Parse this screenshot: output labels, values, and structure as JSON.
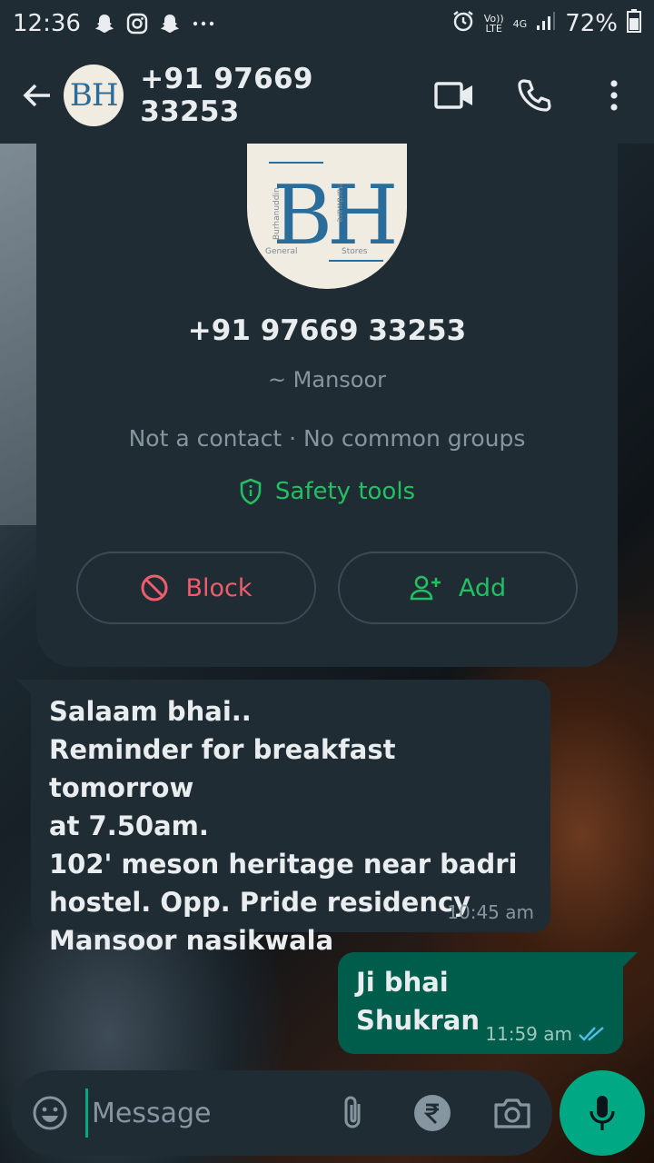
{
  "status_bar": {
    "time": "12:36",
    "network_top": "Vo))",
    "network_bottom": "LTE",
    "signal": "4G",
    "battery": "72%"
  },
  "header": {
    "title": "+91 97669 33253",
    "avatar_text": "BH"
  },
  "contact_card": {
    "phone": "+91 97669 33253",
    "name": "~ Mansoor",
    "info": "Not a contact · No common groups",
    "safety_label": "Safety tools",
    "block_label": "Block",
    "add_label": "Add",
    "avatar_text": "BH",
    "avatar_small_left": "Burhanuddin",
    "avatar_small_right": "Hardware",
    "avatar_bottom_left": "General",
    "avatar_bottom_right": "Stores"
  },
  "messages": [
    {
      "direction": "incoming",
      "text": "Salaam bhai..\nReminder for breakfast tomorrow\nat 7.50am.\n102' meson heritage near badri\nhostel. Opp. Pride residency\nMansoor nasikwala",
      "time": "10:45 am"
    },
    {
      "direction": "outgoing",
      "text": "Ji bhai\nShukran",
      "time": "11:59 am",
      "read": true
    }
  ],
  "composer": {
    "placeholder": "Message"
  },
  "colors": {
    "accent": "#00a884",
    "danger": "#f15c6d",
    "green_text": "#21c063",
    "panel": "#1f2c33",
    "outgoing_bubble": "#005c4b"
  }
}
